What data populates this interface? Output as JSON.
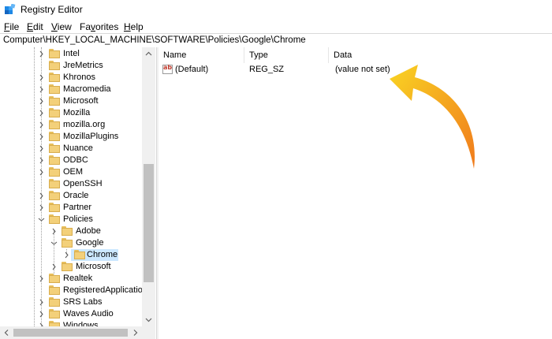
{
  "window": {
    "title": "Registry Editor"
  },
  "menu": [
    {
      "key": "F",
      "rest": "ile"
    },
    {
      "key": "E",
      "rest": "dit"
    },
    {
      "key": "V",
      "rest": "iew"
    },
    {
      "key": "",
      "rest": "Fa",
      "key2": "v",
      "rest2": "orites"
    },
    {
      "key": "H",
      "rest": "elp"
    }
  ],
  "address": {
    "path": "Computer\\HKEY_LOCAL_MACHINE\\SOFTWARE\\Policies\\Google\\Chrome"
  },
  "tree": {
    "items": [
      {
        "label": "Intel"
      },
      {
        "label": "JreMetrics"
      },
      {
        "label": "Khronos"
      },
      {
        "label": "Macromedia"
      },
      {
        "label": "Microsoft"
      },
      {
        "label": "Mozilla"
      },
      {
        "label": "mozilla.org"
      },
      {
        "label": "MozillaPlugins"
      },
      {
        "label": "Nuance"
      },
      {
        "label": "ODBC"
      },
      {
        "label": "OEM"
      },
      {
        "label": "OpenSSH"
      },
      {
        "label": "Oracle"
      },
      {
        "label": "Partner"
      },
      {
        "label": "Policies"
      },
      {
        "label": "Adobe"
      },
      {
        "label": "Google"
      },
      {
        "label": "Chrome"
      },
      {
        "label": "Microsoft"
      },
      {
        "label": "Realtek"
      },
      {
        "label": "RegisteredApplicatio"
      },
      {
        "label": "SRS Labs"
      },
      {
        "label": "Waves Audio"
      },
      {
        "label": "Windows"
      }
    ]
  },
  "list": {
    "columns": {
      "name": "Name",
      "type": "Type",
      "data": "Data"
    },
    "rows": [
      {
        "name": "(Default)",
        "type": "REG_SZ",
        "data": "(value not set)"
      }
    ]
  },
  "colors": {
    "selection": "#cce8ff",
    "arrow_start": "#f9d423",
    "arrow_end": "#f08a24"
  }
}
